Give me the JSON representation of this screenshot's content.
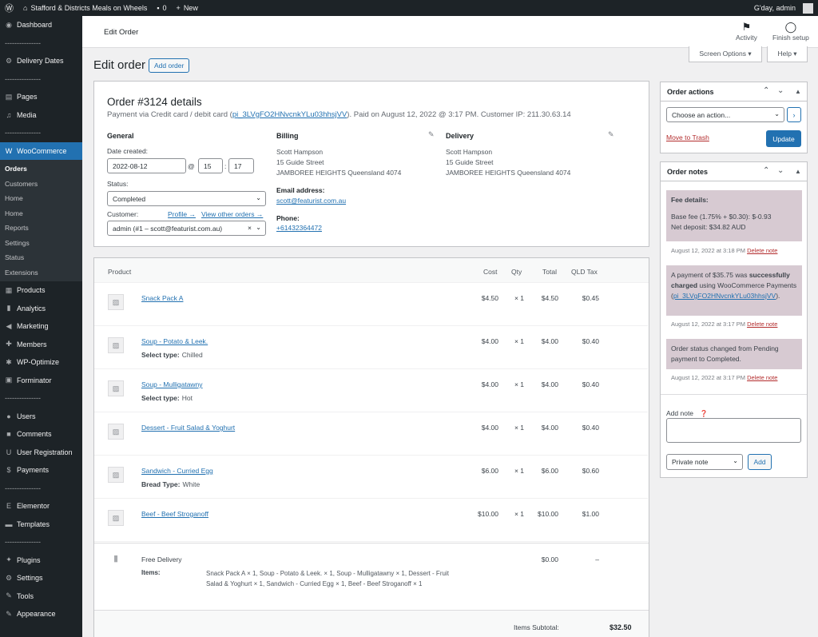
{
  "admin_bar": {
    "site_name": "Stafford & Districts Meals on Wheels",
    "comments_count": "0",
    "new_label": "New",
    "greeting": "G'day, admin"
  },
  "sidebar": {
    "items": [
      {
        "label": "Dashboard",
        "icon": "dashboard-icon",
        "glyph": "◉"
      },
      {
        "sep": "---------------"
      },
      {
        "label": "Delivery Dates",
        "icon": "gear-icon",
        "glyph": "⚙"
      },
      {
        "sep": "---------------"
      },
      {
        "label": "Pages",
        "icon": "pages-icon",
        "glyph": "▤"
      },
      {
        "label": "Media",
        "icon": "media-icon",
        "glyph": "♫"
      },
      {
        "sep": "---------------"
      },
      {
        "label": "WooCommerce",
        "icon": "woocommerce-icon",
        "glyph": "W",
        "active": true
      }
    ],
    "submenu": [
      "Orders",
      "Customers",
      "Home",
      "Home",
      "Reports",
      "Settings",
      "Status",
      "Extensions"
    ],
    "items2": [
      {
        "label": "Products",
        "icon": "products-icon",
        "glyph": "▦"
      },
      {
        "label": "Analytics",
        "icon": "analytics-icon",
        "glyph": "▮"
      },
      {
        "label": "Marketing",
        "icon": "marketing-icon",
        "glyph": "◀"
      },
      {
        "label": "Members",
        "icon": "members-icon",
        "glyph": "✚"
      },
      {
        "label": "WP-Optimize",
        "icon": "wp-optimize-icon",
        "glyph": "✱"
      },
      {
        "label": "Forminator",
        "icon": "forminator-icon",
        "glyph": "▣"
      },
      {
        "sep": "---------------"
      },
      {
        "label": "Users",
        "icon": "users-icon",
        "glyph": "●"
      },
      {
        "label": "Comments",
        "icon": "comments-icon",
        "glyph": "■"
      },
      {
        "label": "User Registration",
        "icon": "user-registration-icon",
        "glyph": "U"
      },
      {
        "label": "Payments",
        "icon": "payments-icon",
        "glyph": "$"
      },
      {
        "sep": "---------------"
      },
      {
        "label": "Elementor",
        "icon": "elementor-icon",
        "glyph": "E"
      },
      {
        "label": "Templates",
        "icon": "templates-icon",
        "glyph": "▬"
      },
      {
        "sep": "---------------"
      },
      {
        "label": "Plugins",
        "icon": "plugins-icon",
        "glyph": "✦"
      },
      {
        "label": "Settings",
        "icon": "settings-icon",
        "glyph": "⚙"
      },
      {
        "label": "Tools",
        "icon": "tools-icon",
        "glyph": "✎"
      },
      {
        "label": "Appearance",
        "icon": "appearance-icon",
        "glyph": "✎"
      }
    ]
  },
  "topbar": {
    "title": "Edit Order",
    "activity_label": "Activity",
    "finish_setup_label": "Finish setup",
    "screen_options_label": "Screen Options ▾",
    "help_label": "Help ▾"
  },
  "page": {
    "heading": "Edit order",
    "add_order_label": "Add order"
  },
  "order": {
    "title": "Order #3124 details",
    "payment_prefix": "Payment via Credit card / debit card (",
    "payment_link": "pi_3LVgFO2HNvcnkYLu03hhsjVV",
    "payment_suffix": "). Paid on August 12, 2022 @ 3:17 PM. Customer IP: 211.30.63.14",
    "general": {
      "heading": "General",
      "date_label": "Date created:",
      "date": "2022-08-12",
      "at": "@",
      "hour": "15",
      "colon": ":",
      "minute": "17",
      "status_label": "Status:",
      "status": "Completed",
      "customer_label": "Customer:",
      "profile_link": "Profile →",
      "other_orders_link": "View other orders →",
      "customer": "admin (#1 – scott@featurist.com.au)"
    },
    "billing": {
      "heading": "Billing",
      "address": [
        "Scott Hampson",
        "15 Guide Street",
        "JAMBOREE HEIGHTS Queensland 4074"
      ],
      "email_label": "Email address:",
      "email": "scott@featurist.com.au",
      "phone_label": "Phone:",
      "phone": "+61432364472"
    },
    "delivery": {
      "heading": "Delivery",
      "address": [
        "Scott Hampson",
        "15 Guide Street",
        "JAMBOREE HEIGHTS Queensland 4074"
      ]
    }
  },
  "items_table": {
    "headers": {
      "product": "Product",
      "cost": "Cost",
      "qty": "Qty",
      "total": "Total",
      "tax": "QLD Tax"
    },
    "rows": [
      {
        "name": "Snack Pack A",
        "meta_label": "",
        "meta_value": "",
        "cost": "$4.50",
        "qty": "× 1",
        "total": "$4.50",
        "tax": "$0.45"
      },
      {
        "name": "Soup - Potato & Leek.",
        "meta_label": "Select type:",
        "meta_value": "Chilled",
        "cost": "$4.00",
        "qty": "× 1",
        "total": "$4.00",
        "tax": "$0.40"
      },
      {
        "name": "Soup - Mulligatawny",
        "meta_label": "Select type:",
        "meta_value": "Hot",
        "cost": "$4.00",
        "qty": "× 1",
        "total": "$4.00",
        "tax": "$0.40"
      },
      {
        "name": "Dessert - Fruit Salad & Yoghurt",
        "meta_label": "",
        "meta_value": "",
        "cost": "$4.00",
        "qty": "× 1",
        "total": "$4.00",
        "tax": "$0.40"
      },
      {
        "name": "Sandwich - Curried Egg",
        "meta_label": "Bread Type:",
        "meta_value": "White",
        "cost": "$6.00",
        "qty": "× 1",
        "total": "$6.00",
        "tax": "$0.60"
      },
      {
        "name": "Beef - Beef Stroganoff",
        "meta_label": "",
        "meta_value": "",
        "cost": "$10.00",
        "qty": "× 1",
        "total": "$10.00",
        "tax": "$1.00"
      }
    ],
    "shipping": {
      "name": "Free Delivery",
      "items_label": "Items:",
      "items_text": "Snack Pack A × 1, Soup - Potato & Leek. × 1, Soup - Mulligatawny × 1, Dessert - Fruit Salad & Yoghurt × 1, Sandwich - Curried Egg × 1, Beef - Beef Stroganoff × 1",
      "total": "$0.00",
      "tax": "–"
    },
    "subtotal_label": "Items Subtotal:",
    "subtotal": "$32.50"
  },
  "order_actions": {
    "title": "Order actions",
    "select": "Choose an action...",
    "trash_link": "Move to Trash",
    "update_label": "Update"
  },
  "order_notes": {
    "title": "Order notes",
    "notes": [
      {
        "date": "August 12, 2022 at 3:18 PM"
      },
      {
        "date": "August 12, 2022 at 3:17 PM"
      },
      {
        "date": "August 12, 2022 at 3:17 PM"
      }
    ],
    "note1": {
      "heading": "Fee details:",
      "line1": "Base fee (1.75% + $0.30): $-0.93",
      "line2": "Net deposit: $34.82 AUD"
    },
    "note2": {
      "pre": "A payment of $35.75 was ",
      "bold": "successfully charged",
      "post": " using WooCommerce Payments (",
      "link": "pi_3LVgFO2HNvcnkYLu03hhsjVV",
      "end": ")."
    },
    "note3": {
      "text": "Order status changed from Pending payment to Completed."
    },
    "delete_label": "Delete note",
    "add_note_label": "Add note",
    "note_type": "Private note",
    "add_button": "Add"
  },
  "colors": {
    "accent": "#2271b1",
    "sidebar": "#1d2327",
    "note_bg": "#d7cad2",
    "trash": "#b32d2e"
  }
}
